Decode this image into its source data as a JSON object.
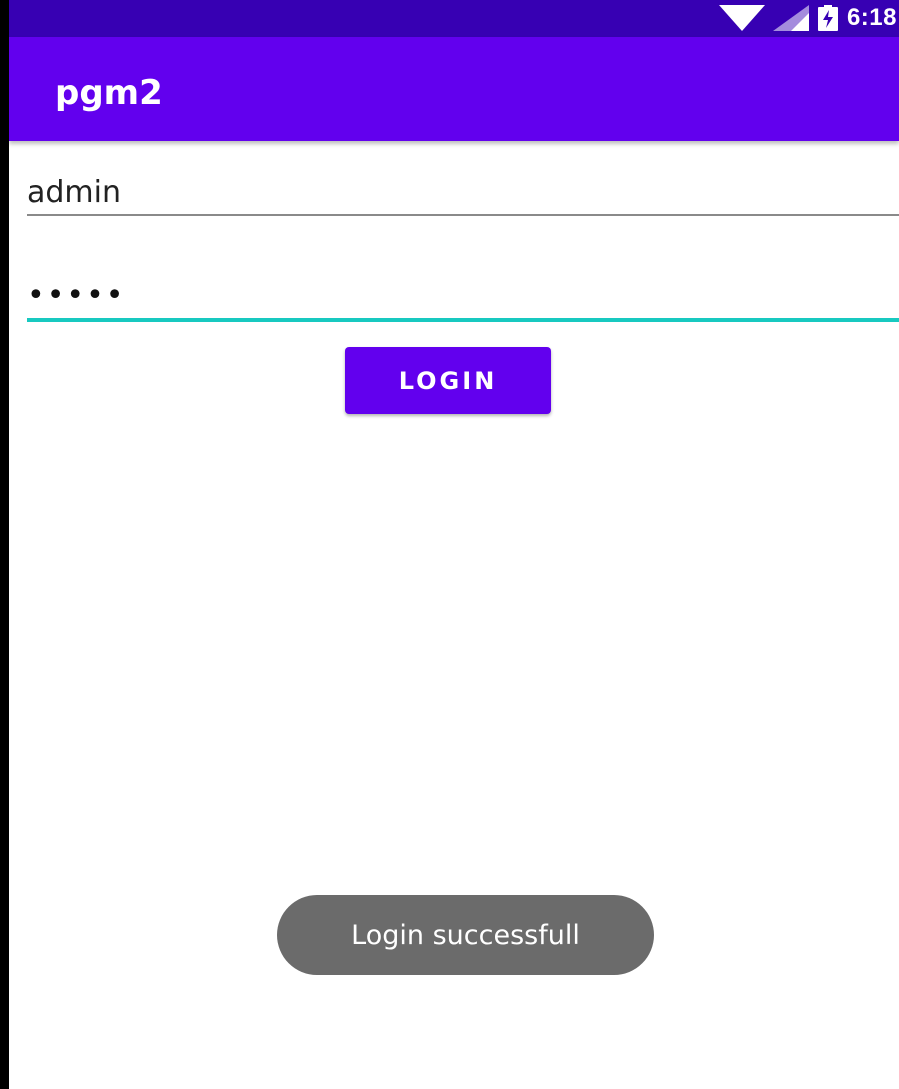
{
  "status_bar": {
    "time": "6:18",
    "icons": [
      "wifi-icon",
      "cell-signal-icon",
      "battery-charging-icon"
    ]
  },
  "app_bar": {
    "title": "pgm2"
  },
  "form": {
    "username_value": "admin",
    "password_value": "admin",
    "login_label": "LOGIN"
  },
  "toast": {
    "message": "Login successfull"
  },
  "colors": {
    "status_bar": "#3700b3",
    "primary": "#6200ee",
    "accent": "#18c9c0",
    "toast": "#6b6b6b"
  }
}
